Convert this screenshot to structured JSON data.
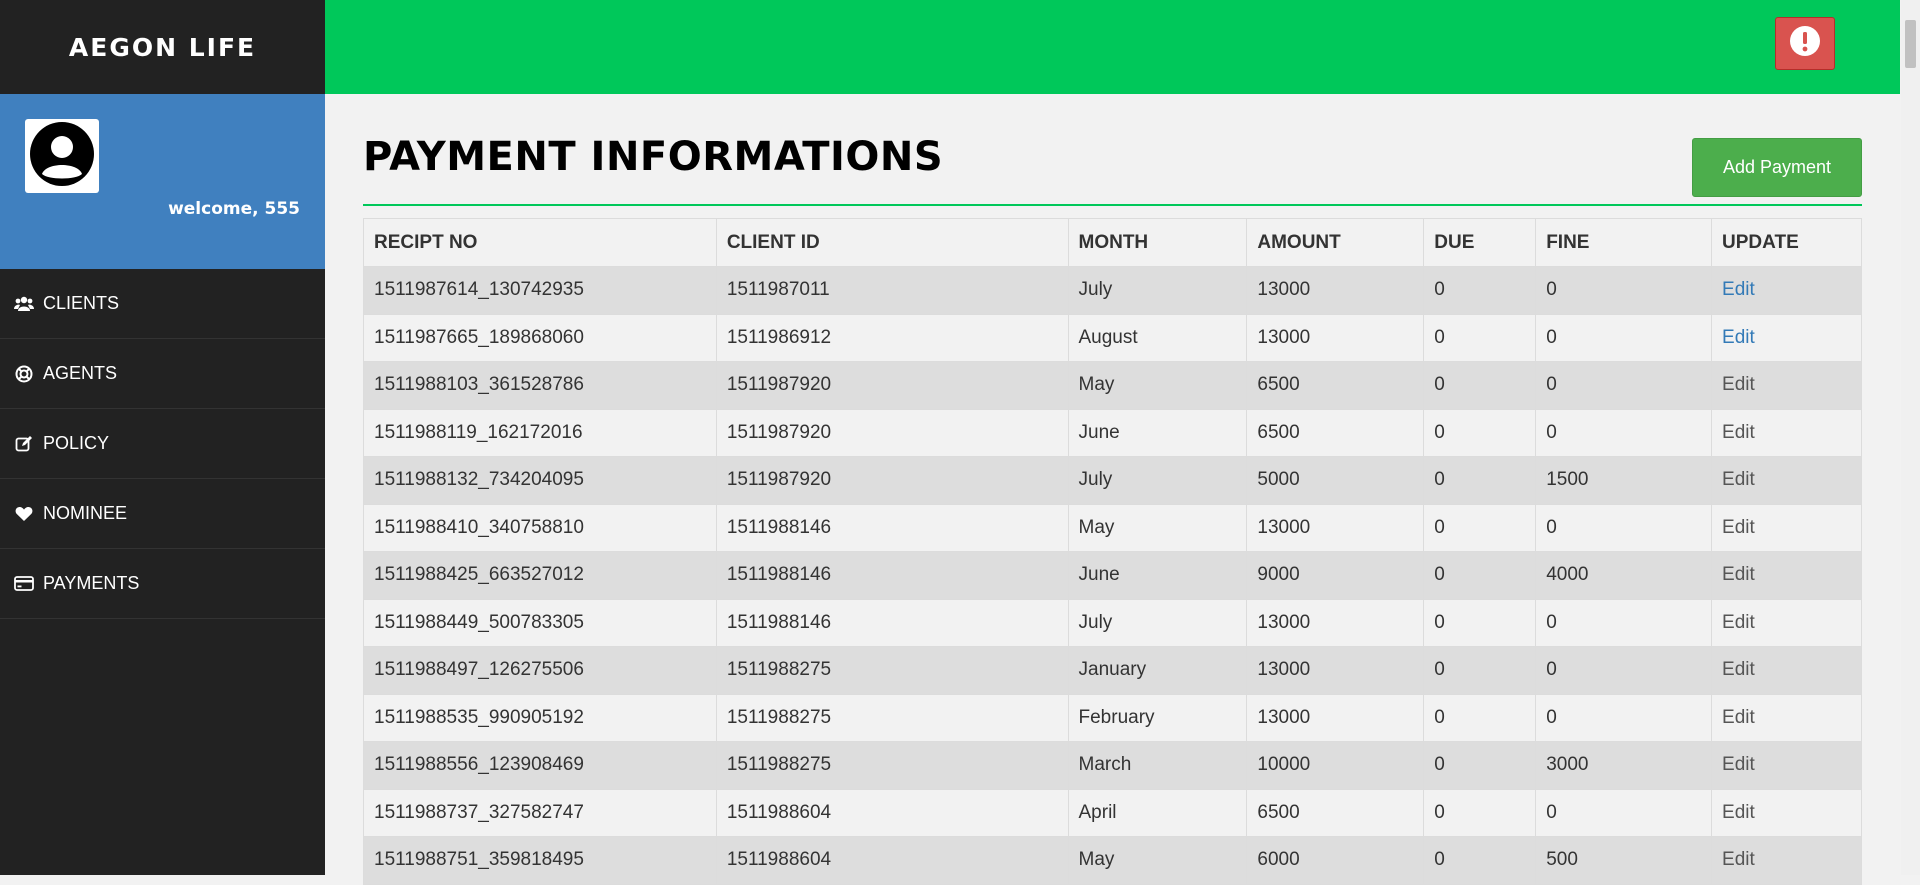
{
  "brand": {
    "name": "AEGON LIFE"
  },
  "profile": {
    "welcome": "welcome, 555",
    "avatar_icon": "user-circle-icon"
  },
  "nav": {
    "items": [
      {
        "label": "CLIENTS",
        "icon": "users-icon"
      },
      {
        "label": "AGENTS",
        "icon": "life-ring-icon"
      },
      {
        "label": "POLICY",
        "icon": "edit-icon"
      },
      {
        "label": "NOMINEE",
        "icon": "heart-icon"
      },
      {
        "label": "PAYMENTS",
        "icon": "credit-card-icon"
      }
    ]
  },
  "topbar": {
    "alert_icon": "exclamation-circle-icon",
    "color": "#00c85a"
  },
  "page": {
    "title": "PAYMENT INFORMATIONS",
    "add_button": "Add Payment"
  },
  "table": {
    "headers": [
      "RECIPT NO",
      "CLIENT ID",
      "MONTH",
      "AMOUNT",
      "DUE",
      "FINE",
      "UPDATE"
    ],
    "rows": [
      [
        "1511987614_130742935",
        "1511987011",
        "July",
        "13000",
        "0",
        "0",
        "Edit"
      ],
      [
        "1511987665_189868060",
        "1511986912",
        "August",
        "13000",
        "0",
        "0",
        "Edit"
      ],
      [
        "1511988103_361528786",
        "1511987920",
        "May",
        "6500",
        "0",
        "0",
        "Edit"
      ],
      [
        "1511988119_162172016",
        "1511987920",
        "June",
        "6500",
        "0",
        "0",
        "Edit"
      ],
      [
        "1511988132_734204095",
        "1511987920",
        "July",
        "5000",
        "0",
        "1500",
        "Edit"
      ],
      [
        "1511988410_340758810",
        "1511988146",
        "May",
        "13000",
        "0",
        "0",
        "Edit"
      ],
      [
        "1511988425_663527012",
        "1511988146",
        "June",
        "9000",
        "0",
        "4000",
        "Edit"
      ],
      [
        "1511988449_500783305",
        "1511988146",
        "July",
        "13000",
        "0",
        "0",
        "Edit"
      ],
      [
        "1511988497_126275506",
        "1511988275",
        "January",
        "13000",
        "0",
        "0",
        "Edit"
      ],
      [
        "1511988535_990905192",
        "1511988275",
        "February",
        "13000",
        "0",
        "0",
        "Edit"
      ],
      [
        "1511988556_123908469",
        "1511988275",
        "March",
        "10000",
        "0",
        "3000",
        "Edit"
      ],
      [
        "1511988737_327582747",
        "1511988604",
        "April",
        "6500",
        "0",
        "0",
        "Edit"
      ],
      [
        "1511988751_359818495",
        "1511988604",
        "May",
        "6000",
        "0",
        "500",
        "Edit"
      ]
    ]
  }
}
